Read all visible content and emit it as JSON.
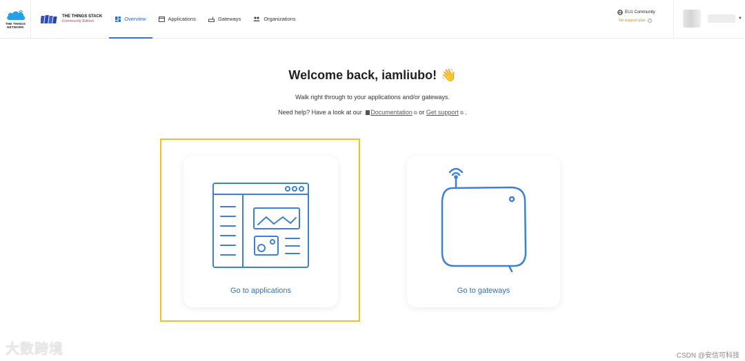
{
  "brand": {
    "ttn_text": "THE THINGS NETWORK",
    "stack_title": "THE THINGS STACK",
    "stack_edition": "Community Edition"
  },
  "nav": {
    "items": [
      {
        "label": "Overview",
        "icon": "dashboard-icon"
      },
      {
        "label": "Applications",
        "icon": "window-icon"
      },
      {
        "label": "Gateways",
        "icon": "router-icon"
      },
      {
        "label": "Organizations",
        "icon": "people-icon"
      }
    ],
    "active": "Overview"
  },
  "cluster": {
    "name": "EU1 Community",
    "plan": "No support plan"
  },
  "main": {
    "title": "Welcome back, iamliubo!",
    "wave": "👋",
    "subtitle": "Walk right through to your applications and/or gateways.",
    "help_prefix": "Need help? Have a look at our",
    "doc_link": "Documentation",
    "or": "or",
    "support_link": "Get support",
    "period": "."
  },
  "cards": {
    "applications": "Go to applications",
    "gateways": "Go to gateways"
  },
  "watermarks": {
    "left": "大数跨境",
    "right": "CSDN @安信可科技"
  },
  "colors": {
    "accent": "#2e72de",
    "highlight": "#f5c21b",
    "plan": "#c8902b",
    "brand_red": "#e23c3c"
  }
}
